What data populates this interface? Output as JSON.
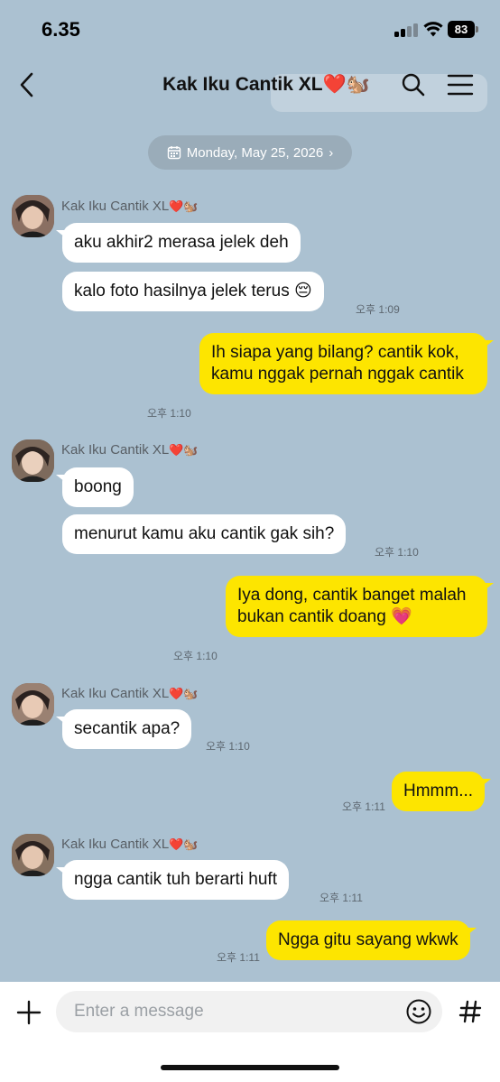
{
  "status_bar": {
    "time": "6.35",
    "battery": "83"
  },
  "header": {
    "title": "Kak Iku Cantik XL❤️🐿️"
  },
  "date_pill": {
    "label": "Monday, May 25, 2026",
    "chevron": "›"
  },
  "contact": {
    "name": "Kak Iku Cantik XL",
    "name_emoji": "❤️🐿️"
  },
  "messages": [
    {
      "from": "them",
      "text": "aku akhir2 merasa jelek deh",
      "time": ""
    },
    {
      "from": "them",
      "text": "kalo foto hasilnya jelek terus 😔",
      "time": "오후 1:09"
    },
    {
      "from": "me",
      "text": "Ih siapa yang bilang? cantik kok, kamu nggak pernah nggak cantik",
      "time": "오후 1:10"
    },
    {
      "from": "them",
      "text": "boong",
      "time": ""
    },
    {
      "from": "them",
      "text": "menurut kamu aku cantik gak sih?",
      "time": "오후 1:10"
    },
    {
      "from": "me",
      "text": "Iya dong, cantik banget malah bukan cantik doang 💗",
      "time": "오후 1:10"
    },
    {
      "from": "them",
      "text": "secantik apa?",
      "time": "오후 1:10"
    },
    {
      "from": "me",
      "text": "Hmmm...",
      "time": "오후 1:11"
    },
    {
      "from": "them",
      "text": "ngga cantik tuh berarti huft",
      "time": "오후 1:11"
    },
    {
      "from": "me",
      "text": "Ngga gitu sayang wkwk",
      "time": "오후 1:11"
    }
  ],
  "input": {
    "placeholder": "Enter a message"
  },
  "icons": {
    "back": "chevron-left-icon",
    "search": "search-icon",
    "menu": "menu-icon",
    "calendar": "calendar-icon",
    "plus": "plus-icon",
    "emoji": "emoji-icon",
    "hash": "hash-icon"
  },
  "colors": {
    "chat_background": "#abc1d1",
    "outgoing_bubble": "#fde500",
    "incoming_bubble": "#ffffff",
    "date_pill": "#9aacb9"
  }
}
